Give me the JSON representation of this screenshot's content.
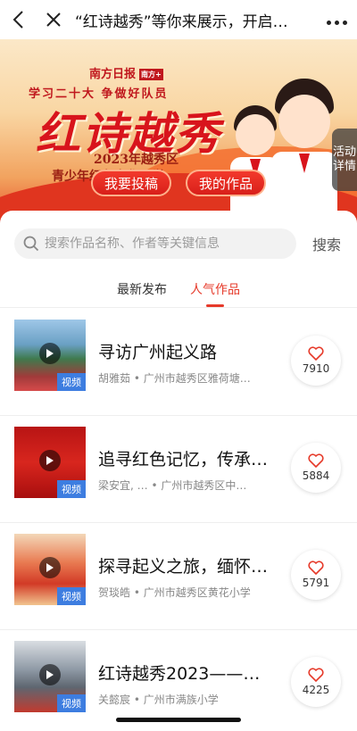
{
  "nav": {
    "title": "“红诗越秀”等你来展示，开启…",
    "back_icon": "chevron-left-icon",
    "close_icon": "close-icon",
    "more_icon": "more-dots-icon"
  },
  "banner": {
    "brand": "南方日报",
    "brand_seal": "南方+",
    "slogan": "学习二十大 争做好队员",
    "title": "红诗越秀",
    "subtitle_line1": "2023年越秀区",
    "subtitle_line2": "青少年红色文化研学",
    "submit_label": "我要投稿",
    "my_works_label": "我的作品",
    "side_tab_line1": "活动",
    "side_tab_line2": "详情"
  },
  "search": {
    "placeholder": "搜索作品名称、作者等关键信息",
    "button_label": "搜索"
  },
  "tabs": [
    {
      "label": "最新发布"
    },
    {
      "label": "人气作品"
    }
  ],
  "active_tab": "人气作品",
  "items": [
    {
      "title": "寻访广州起义路",
      "meta": "胡雅茹 • 广州市越秀区雅荷塘…",
      "likes": "7910",
      "badge": "视频"
    },
    {
      "title": "追寻红色记忆，传承…",
      "meta": "梁安宜, … • 广州市越秀区中…",
      "likes": "5884",
      "badge": "视频"
    },
    {
      "title": "探寻起义之旅，缅怀…",
      "meta": "贺琰皓 • 广州市越秀区黄花小学",
      "likes": "5791",
      "badge": "视频"
    },
    {
      "title": "红诗越秀2023——…",
      "meta": "关懿宸 • 广州市满族小学",
      "likes": "4225",
      "badge": "视频"
    }
  ],
  "colors": {
    "accent": "#e63a2a",
    "badge": "#3d7de0"
  }
}
